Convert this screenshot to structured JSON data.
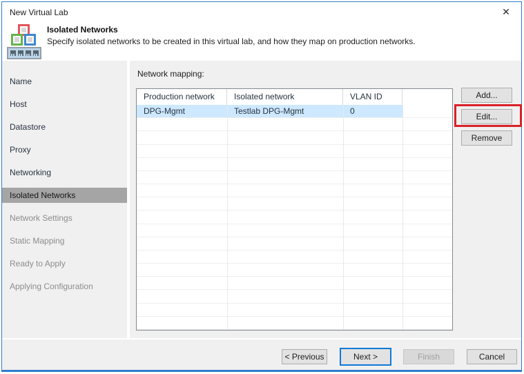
{
  "window": {
    "title": "New Virtual Lab",
    "close_glyph": "✕"
  },
  "header": {
    "title": "Isolated Networks",
    "description": "Specify isolated networks to be created in this virtual lab, and how they map on production networks."
  },
  "sidebar": {
    "items": [
      {
        "label": "Name",
        "state": "done"
      },
      {
        "label": "Host",
        "state": "done"
      },
      {
        "label": "Datastore",
        "state": "done"
      },
      {
        "label": "Proxy",
        "state": "done"
      },
      {
        "label": "Networking",
        "state": "done"
      },
      {
        "label": "Isolated Networks",
        "state": "current"
      },
      {
        "label": "Network Settings",
        "state": "upcoming"
      },
      {
        "label": "Static Mapping",
        "state": "upcoming"
      },
      {
        "label": "Ready to Apply",
        "state": "upcoming"
      },
      {
        "label": "Applying Configuration",
        "state": "upcoming"
      }
    ]
  },
  "main": {
    "table_label": "Network mapping:",
    "table": {
      "columns": [
        "Production network",
        "Isolated network",
        "VLAN ID"
      ],
      "rows": [
        {
          "production_network": "DPG-Mgmt",
          "isolated_network": "Testlab DPG-Mgmt",
          "vlan_id": "0",
          "selected": true
        }
      ],
      "empty_row_count": 16
    },
    "actions": [
      {
        "label": "Add...",
        "annotated": false
      },
      {
        "label": "Edit...",
        "annotated": true
      },
      {
        "label": "Remove",
        "annotated": false
      }
    ]
  },
  "footer": {
    "buttons": [
      {
        "label": "< Previous",
        "state": "normal"
      },
      {
        "label": "Next >",
        "state": "default"
      },
      {
        "label": "Finish",
        "state": "disabled"
      },
      {
        "label": "Cancel",
        "state": "normal"
      }
    ]
  },
  "colors": {
    "window_border": "#2e7dcc",
    "body_background": "#f0f0f0",
    "selected_row": "#cde8ff",
    "sidebar_selected": "#a5a5a5",
    "annotation": "#da2028",
    "default_button_border": "#0f78d7"
  }
}
